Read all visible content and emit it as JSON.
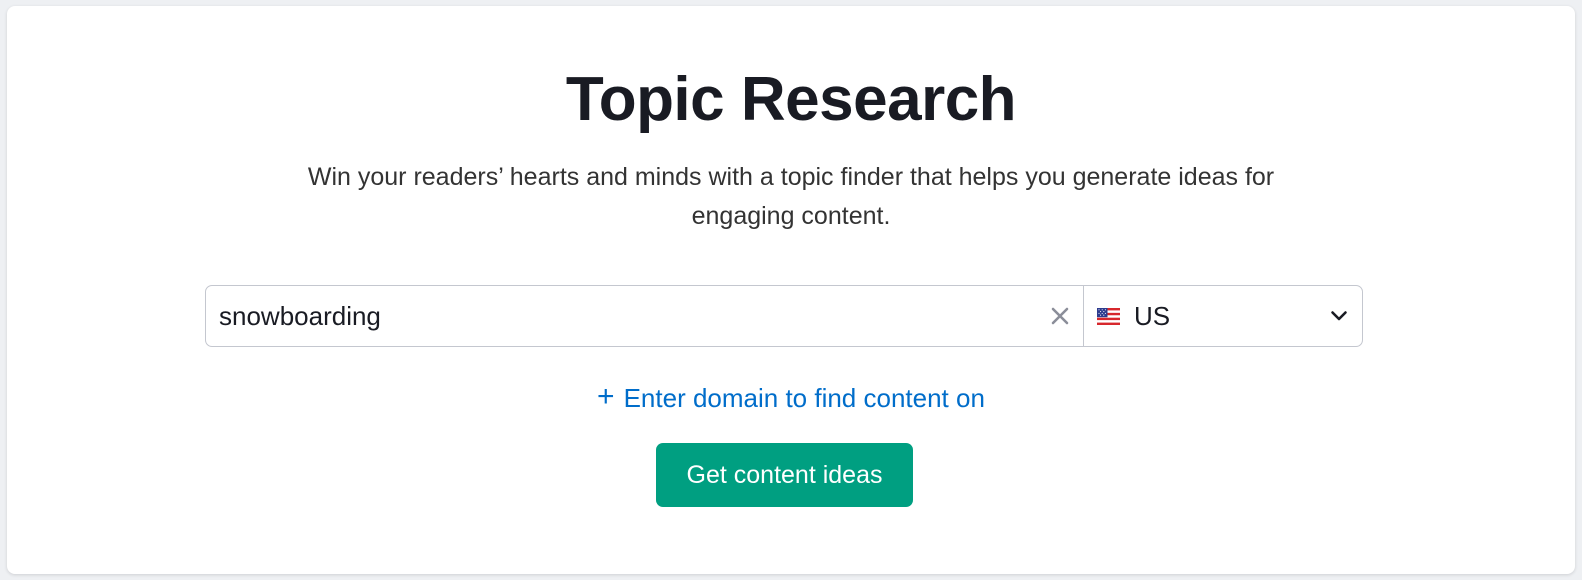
{
  "page": {
    "title": "Topic Research",
    "subtitle": "Win your readers’ hearts and minds with a topic finder that helps you generate ideas for engaging content."
  },
  "search": {
    "value": "snowboarding",
    "clear_icon": "close-icon"
  },
  "database": {
    "flag_icon": "us-flag-icon",
    "selected": "US",
    "chevron_icon": "chevron-down-icon"
  },
  "domain_link": {
    "icon": "plus-icon",
    "plus": "+",
    "label": "Enter domain to find content on"
  },
  "cta": {
    "label": "Get content ideas"
  },
  "colors": {
    "page_background": "#eef0f3",
    "card_background": "#ffffff",
    "title_text": "#191b23",
    "link": "#006dca",
    "cta_background": "#009f81",
    "cta_text": "#ffffff",
    "border": "#c4c7cf"
  }
}
